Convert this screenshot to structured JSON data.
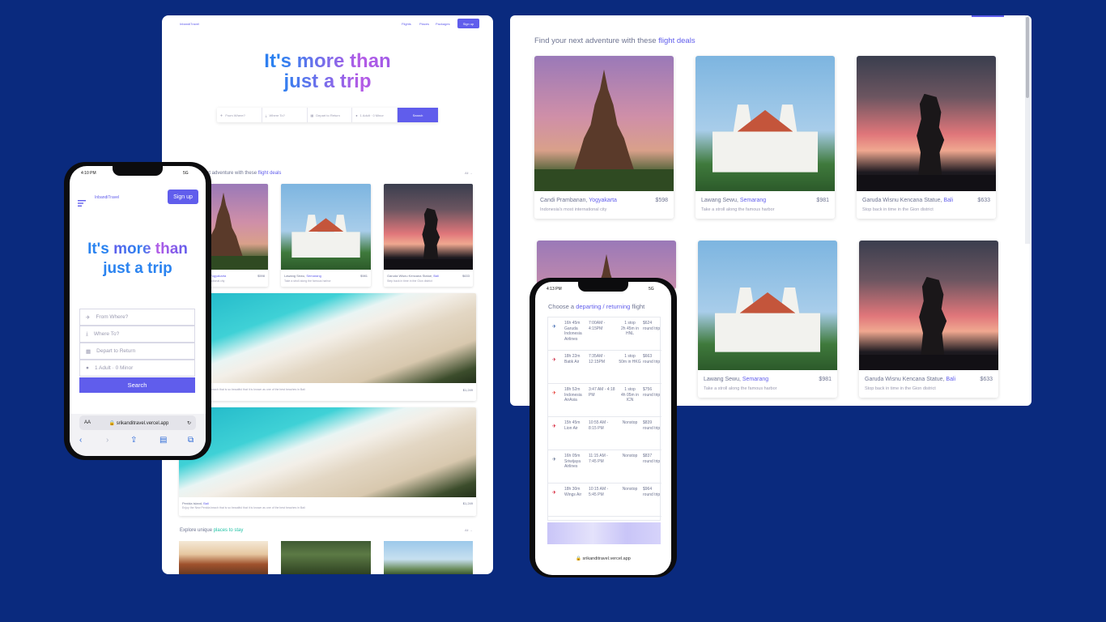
{
  "desktop": {
    "logo": "Inbandi7ravel",
    "nav": [
      "Flights",
      "Places",
      "Packages"
    ],
    "signup": "Sign up",
    "hero_line1": "It's more than",
    "hero_line2": "just a trip",
    "search": {
      "from": "From Where?",
      "to": "Where To?",
      "date": "Depart to Return",
      "pax": "1 Adult · 0 Minor",
      "button": "Search"
    },
    "deals_title_a": "Find your next adventure with these",
    "deals_title_b": "flight deals",
    "all_link": "All →",
    "cards": [
      {
        "name": "Candi Prambanan, ",
        "city": "Yogyakarta",
        "price": "$598",
        "desc": "Indonesia's most international city"
      },
      {
        "name": "Lawang Sewu, ",
        "city": "Semarang",
        "price": "$981",
        "desc": "Take a stroll along the famous harbor"
      },
      {
        "name": "Garuda Wisnu Kencana Statue, ",
        "city": "Bali",
        "price": "$633",
        "desc": "Step back in time in the Gion district"
      }
    ],
    "wide1": {
      "desc": "Enjoy the New Penida beach that is so beautiful that it is known as one of the best beaches in Bali",
      "price": "$1,249"
    },
    "wide2": {
      "name": "Penida island, ",
      "city": "Bali",
      "desc": "Enjoy the New Penida beach that is so beautiful that it is known as one of the best beaches in Bali",
      "price": "$1,249"
    },
    "explore_a": "Explore unique",
    "explore_b": "places to stay",
    "explore_all": "All →"
  },
  "right": {
    "title_a": "Find your next adventure with these",
    "title_b": "flight deals",
    "cards": [
      {
        "name": "Candi Prambanan, ",
        "city": "Yogyakarta",
        "price": "$598",
        "desc": "Indonesia's most international city"
      },
      {
        "name": "Lawang Sewu, ",
        "city": "Semarang",
        "price": "$981",
        "desc": "Take a stroll along the famous harbor"
      },
      {
        "name": "Garuda Wisnu Kencana Statue, ",
        "city": "Bali",
        "price": "$633",
        "desc": "Stop back in time in the Gion district"
      },
      {
        "name": "Lawang Sewu, ",
        "city": "Semarang",
        "price": "$981",
        "desc": "Take a stroll along the famous harbor"
      },
      {
        "name": "Garuda Wisnu Kencana Statue, ",
        "city": "Bali",
        "price": "$633",
        "desc": "Stop back in time in the Gion district"
      }
    ]
  },
  "phone1": {
    "time": "4:10 PM",
    "signal": "5G",
    "logo": "InbandiTravel",
    "signup": "Sign up",
    "hero_line1_a": "It's ",
    "hero_line1_b": "more than",
    "hero_line2": "just a trip",
    "from": "From Where?",
    "to": "Where To?",
    "date": "Depart to Return",
    "pax": "1 Adult · 0 Minor",
    "search": "Search",
    "aa": "AA",
    "url": "🔒 srikanditravel.vercel.app"
  },
  "phone2": {
    "time": "4:13 PM",
    "signal": "5G",
    "choose_a": "Choose a ",
    "choose_b": "departing / returning",
    "choose_c": " flight",
    "flights": [
      {
        "dur": "16h 45m",
        "airline": "Garuda Indonesia Airlines",
        "times": "7:00AM - 4:15PM",
        "stops": "1 stop",
        "layover": "2h 45m in HNL",
        "price": "$624",
        "trip": "round trip",
        "logo_color": "#2b5aa8"
      },
      {
        "dur": "18h 22m",
        "airline": "Batik Air",
        "times": "7:35AM - 12:15PM",
        "stops": "1 stop",
        "layover": "50m in HKG",
        "price": "$663",
        "trip": "round trip",
        "logo_color": "#c8102e"
      },
      {
        "dur": "18h 52m",
        "airline": "Indonesia AirAsia",
        "times": "3:47 AM - 4:18 PM",
        "stops": "1 stop",
        "layover": "4h 05m in ICN",
        "price": "$756",
        "trip": "round trip",
        "logo_color": "#e2231a"
      },
      {
        "dur": "15h 45m",
        "airline": "Lion Air",
        "times": "10:55 AM - 8:15 PM",
        "stops": "Nonstop",
        "layover": "",
        "price": "$839",
        "trip": "round trip",
        "logo_color": "#d0021b"
      },
      {
        "dur": "16h 05m",
        "airline": "Sriwijaya Airlines",
        "times": "11:15 AM - 7:45 PM",
        "stops": "Nonstop",
        "layover": "",
        "price": "$837",
        "trip": "round trip",
        "logo_color": "#5a6a8a"
      },
      {
        "dur": "18h 30m",
        "airline": "Wings Air",
        "times": "10:15 AM - 5:45 PM",
        "stops": "Nonstop",
        "layover": "",
        "price": "$964",
        "trip": "round trip",
        "logo_color": "#d0021b"
      }
    ],
    "url": "🔒 srikanditravel.vercel.app"
  }
}
